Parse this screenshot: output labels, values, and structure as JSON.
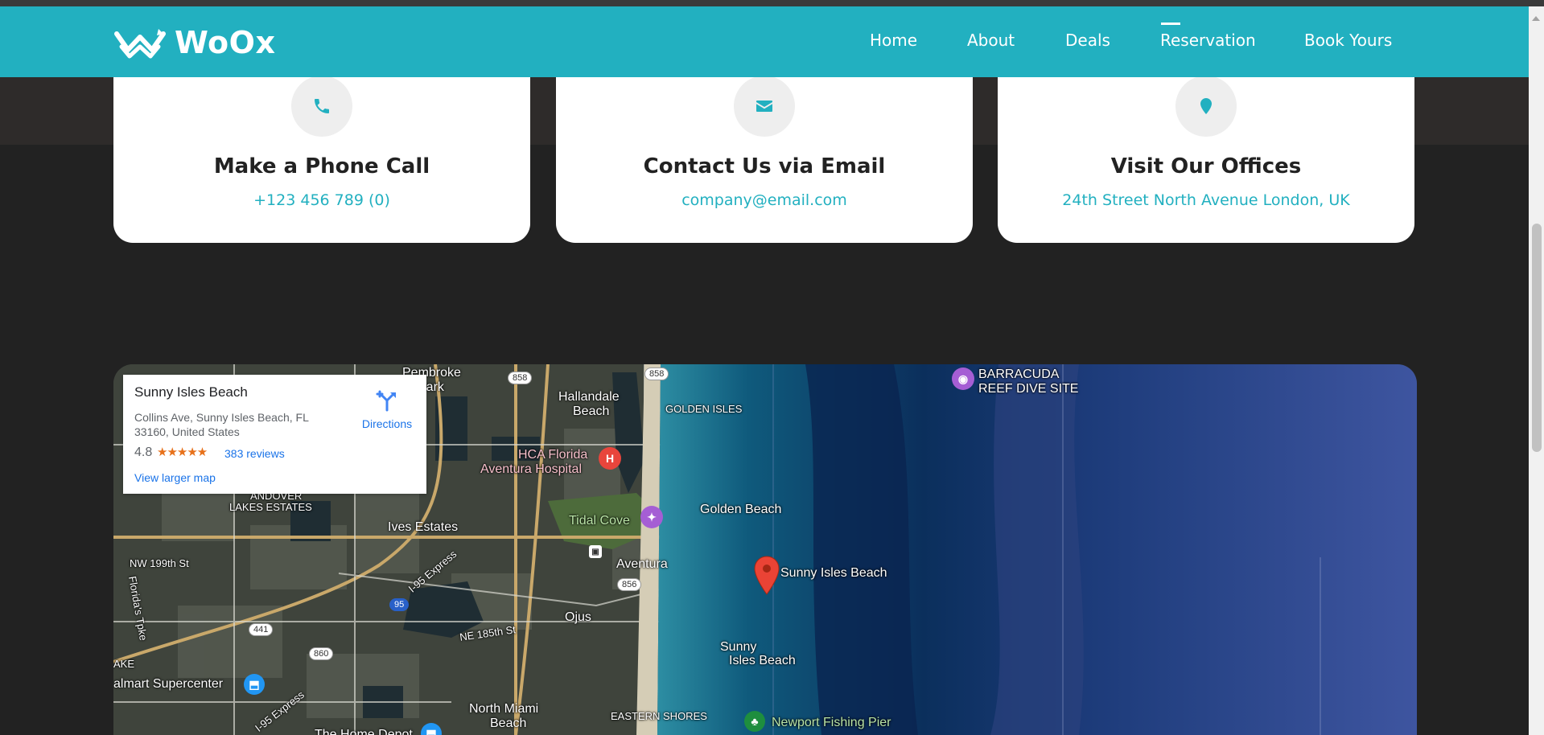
{
  "brand": {
    "name": "WoOx",
    "accent": "#22b0c0"
  },
  "nav": {
    "items": [
      {
        "label": "Home"
      },
      {
        "label": "About"
      },
      {
        "label": "Deals"
      },
      {
        "label": "Reservation",
        "active": true
      },
      {
        "label": "Book Yours"
      }
    ]
  },
  "contact_cards": [
    {
      "icon": "phone-icon",
      "title": "Make a Phone Call",
      "value": "+123 456 789 (0)"
    },
    {
      "icon": "envelope-icon",
      "title": "Contact Us via Email",
      "value": "company@email.com"
    },
    {
      "icon": "map-pin-icon",
      "title": "Visit Our Offices",
      "value": "24th Street North Avenue London, UK"
    }
  ],
  "map": {
    "info": {
      "place": "Sunny Isles Beach",
      "address": "Collins Ave, Sunny Isles Beach, FL 33160, United States",
      "rating": "4.8",
      "stars": "★★★★★",
      "reviews": "383 reviews",
      "directions": "Directions",
      "larger_map": "View larger map"
    },
    "labels": {
      "pembroke": "Pembroke",
      "park": "Park",
      "hallandale": "Hallandale",
      "beach": "Beach",
      "golden_isles": "GOLDEN ISLES",
      "barracuda": "BARRACUDA",
      "reef_dive_site": "REEF DIVE SITE",
      "hca_florida": "HCA Florida",
      "aventura_hospital": "Aventura Hospital",
      "andover": "ANDOVER",
      "lakes_estates": "LAKES ESTATES",
      "tidal_cove": "Tidal Cove",
      "golden_beach": "Golden Beach",
      "ives_estates": "Ives Estates",
      "aventura": "Aventura",
      "sunny_isles_beach_pin": "Sunny Isles Beach",
      "nw_199th": "NW 199th St",
      "florida_tpke": "Florida's Tpke",
      "i95_express": "I-95 Express",
      "ne_185th": "NE 185th St",
      "ojus": "Ojus",
      "sunny": "Sunny",
      "isles_beach": "Isles Beach",
      "ake": "AKE",
      "walmart": "almart Supercenter",
      "i95_express_2": "I-95 Express",
      "north_miami": "North Miami",
      "north_miami_beach": "Beach",
      "eastern_shores": "EASTERN SHORES",
      "newport_pier": "Newport Fishing Pier",
      "home_depot": "The Home Depot",
      "rt_858a": "858",
      "rt_858b": "858",
      "rt_856": "856",
      "rt_441": "441",
      "rt_860": "860",
      "rt_95": "95",
      "hospital_h": "H"
    }
  }
}
